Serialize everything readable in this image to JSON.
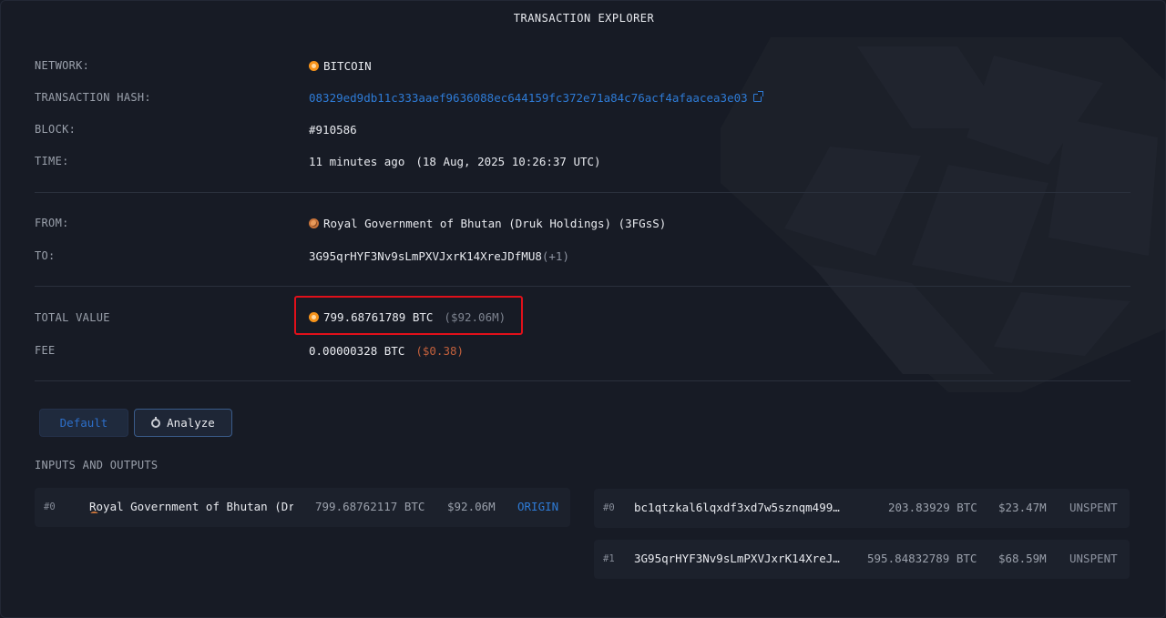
{
  "title": "TRANSACTION EXPLORER",
  "details": {
    "network_label": "NETWORK:",
    "network_value": "BITCOIN",
    "hash_label": "TRANSACTION HASH:",
    "hash_value": "08329ed9db11c333aaef9636088ec644159fc372e71a84c76acf4afaacea3e03",
    "block_label": "BLOCK:",
    "block_value": "#910586",
    "time_label": "TIME:",
    "time_relative": "11 minutes ago",
    "time_absolute": "(18 Aug, 2025 10:26:37 UTC)",
    "from_label": "FROM:",
    "from_value": "Royal Government of Bhutan (Druk Holdings) (3FGsS)",
    "to_label": "TO:",
    "to_value": "3G95qrHYF3Nv9sLmPXVJxrK14XreJDfMU8",
    "to_extra": "(+1)",
    "total_label": "TOTAL VALUE",
    "total_btc": "799.68761789 BTC",
    "total_usd": "($92.06M)",
    "fee_label": "FEE",
    "fee_btc": "0.00000328 BTC",
    "fee_usd": "($0.38)"
  },
  "tabs": {
    "default_label": "Default",
    "analyze_label": "Analyze"
  },
  "io": {
    "title": "INPUTS AND OUTPUTS",
    "inputs": [
      {
        "index": "#0",
        "name": "Royal Government of Bhutan (Druk Holdings)",
        "btc": "799.68762117 BTC",
        "usd": "$92.06M",
        "status": "ORIGIN"
      }
    ],
    "outputs": [
      {
        "index": "#0",
        "address": "bc1qtzkal6lqxdf3xd7w5sznqm499…",
        "btc": "203.83929 BTC",
        "usd": "$23.47M",
        "status": "UNSPENT"
      },
      {
        "index": "#1",
        "address": "3G95qrHYF3Nv9sLmPXVJxrK14XreJ…",
        "btc": "595.84832789 BTC",
        "usd": "$68.59M",
        "status": "UNSPENT"
      }
    ]
  },
  "colors": {
    "background": "#171b25",
    "accent": "#2e7bd6",
    "bitcoin": "#f7931a",
    "highlight": "#e0101a",
    "fee_usd": "#c2603c"
  }
}
